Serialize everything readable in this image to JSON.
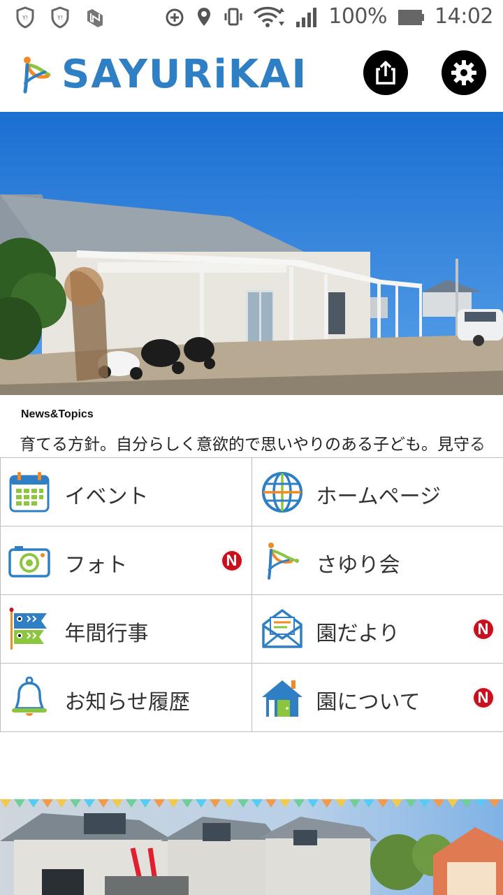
{
  "status_bar": {
    "battery": "100%",
    "time": "14:02"
  },
  "header": {
    "logo_text": "SAYURiKAI",
    "share_icon": "share-icon",
    "settings_icon": "gear-icon"
  },
  "news": {
    "title": "News&Topics",
    "ticker": "育てる方針。自分らしく意欲的で思いやりのある子ども。見守る"
  },
  "menu": [
    {
      "label": "イベント",
      "icon": "calendar-icon",
      "badge": ""
    },
    {
      "label": "ホームページ",
      "icon": "globe-icon",
      "badge": ""
    },
    {
      "label": "フォト",
      "icon": "camera-icon",
      "badge": "N"
    },
    {
      "label": "さゆり会",
      "icon": "sayurikai-logo-icon",
      "badge": ""
    },
    {
      "label": "年間行事",
      "icon": "koinobori-icon",
      "badge": ""
    },
    {
      "label": "園だより",
      "icon": "mail-icon",
      "badge": "N"
    },
    {
      "label": "お知らせ履歴",
      "icon": "bell-icon",
      "badge": ""
    },
    {
      "label": "園について",
      "icon": "house-icon",
      "badge": "N"
    }
  ],
  "colors": {
    "brand_blue": "#2e7fc4",
    "accent_orange": "#f08a24",
    "accent_green": "#8cc63f",
    "badge_red": "#c8101e"
  }
}
